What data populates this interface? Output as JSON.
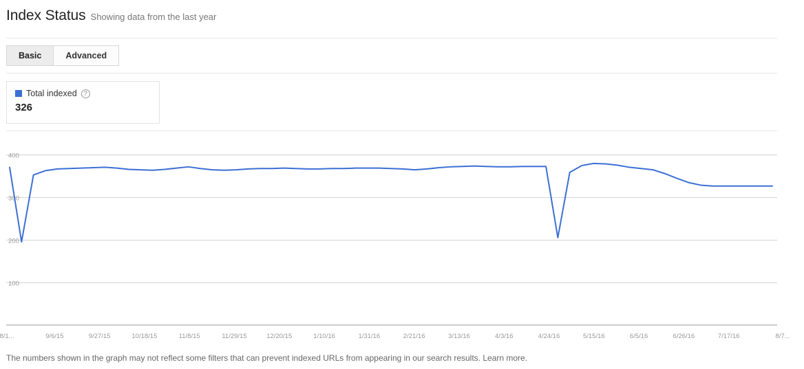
{
  "header": {
    "title": "Index Status",
    "subtitle": "Showing data from the last year"
  },
  "tabs": [
    {
      "label": "Basic",
      "selected": true,
      "name": "tab-basic"
    },
    {
      "label": "Advanced",
      "selected": false,
      "name": "tab-advanced"
    }
  ],
  "legend": {
    "label": "Total indexed",
    "value": "326",
    "help_icon": "help-circle-icon",
    "swatch_color": "#3b6fd4"
  },
  "footer": {
    "text": "The numbers shown in the graph may not reflect some filters that can prevent indexed URLs from appearing in our search results.",
    "link_label": "Learn more."
  },
  "chart_data": {
    "type": "line",
    "title": "Index Status",
    "xlabel": "",
    "ylabel": "",
    "ylim": [
      0,
      440
    ],
    "y_ticks": [
      400,
      300,
      200,
      100
    ],
    "grid": true,
    "legend_position": "top-left",
    "line_color": "#3b6fd4",
    "x_tick_labels": [
      "8/1...",
      "9/6/15",
      "9/27/15",
      "10/18/15",
      "11/8/15",
      "11/29/15",
      "12/20/15",
      "1/10/16",
      "1/31/16",
      "2/21/16",
      "3/13/16",
      "4/3/16",
      "4/24/16",
      "5/15/16",
      "6/5/16",
      "6/26/16",
      "7/17/16",
      "8/7..."
    ],
    "series": [
      {
        "name": "Total indexed",
        "values": [
          370,
          195,
          352,
          362,
          366,
          367,
          368,
          369,
          370,
          368,
          365,
          364,
          363,
          365,
          368,
          371,
          367,
          364,
          363,
          364,
          366,
          367,
          367,
          368,
          367,
          366,
          366,
          367,
          367,
          368,
          368,
          368,
          367,
          366,
          364,
          366,
          369,
          371,
          372,
          373,
          372,
          371,
          371,
          372,
          372,
          372,
          205,
          358,
          374,
          379,
          378,
          375,
          370,
          367,
          364,
          355,
          344,
          334,
          328,
          326,
          326,
          326,
          326,
          326,
          326
        ]
      }
    ]
  }
}
